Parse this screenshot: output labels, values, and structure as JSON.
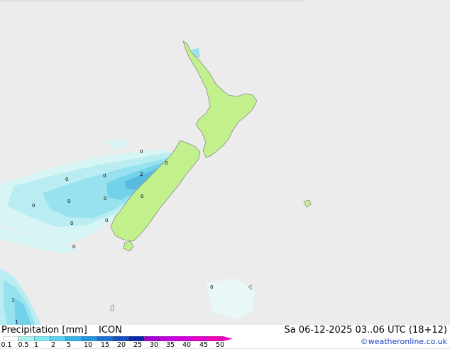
{
  "title": "Precipitation [mm]",
  "model": "ICON",
  "valid_time": "Sa 06-12-2025 03..06 UTC (18+12)",
  "credit": "©weatheronline.co.uk",
  "legend": {
    "labels": [
      "0.1",
      "0.5",
      "1",
      "2",
      "5",
      "10",
      "15",
      "20",
      "25",
      "30",
      "35",
      "40",
      "45",
      "50"
    ],
    "colors": [
      "#ffffff",
      "#a8f0f0",
      "#80e6f0",
      "#5cd2ec",
      "#3cb4e8",
      "#2894dc",
      "#2070d0",
      "#1850c0",
      "#0a28a8",
      "#a000d0",
      "#c000e0",
      "#d000d8",
      "#e000c8",
      "#f000b8"
    ]
  },
  "map_labels": [
    {
      "text": "0",
      "id": "pt-a"
    },
    {
      "text": "0",
      "id": "pt-b"
    },
    {
      "text": "0",
      "id": "pt-c"
    },
    {
      "text": "2",
      "id": "pt-d"
    },
    {
      "text": "0",
      "id": "pt-e"
    },
    {
      "text": "0",
      "id": "pt-f"
    },
    {
      "text": "0",
      "id": "pt-g"
    },
    {
      "text": "0",
      "id": "pt-h"
    },
    {
      "text": "0",
      "id": "pt-i"
    },
    {
      "text": "0",
      "id": "pt-j"
    },
    {
      "text": "0",
      "id": "pt-k"
    },
    {
      "text": "0",
      "id": "pt-l"
    },
    {
      "text": "0",
      "id": "pt-m"
    },
    {
      "text": "1",
      "id": "pt-n"
    },
    {
      "text": "1",
      "id": "pt-o"
    }
  ],
  "colors": {
    "land": "#c2f08c",
    "sea": "#ececec",
    "coast": "#8c8c8c"
  }
}
